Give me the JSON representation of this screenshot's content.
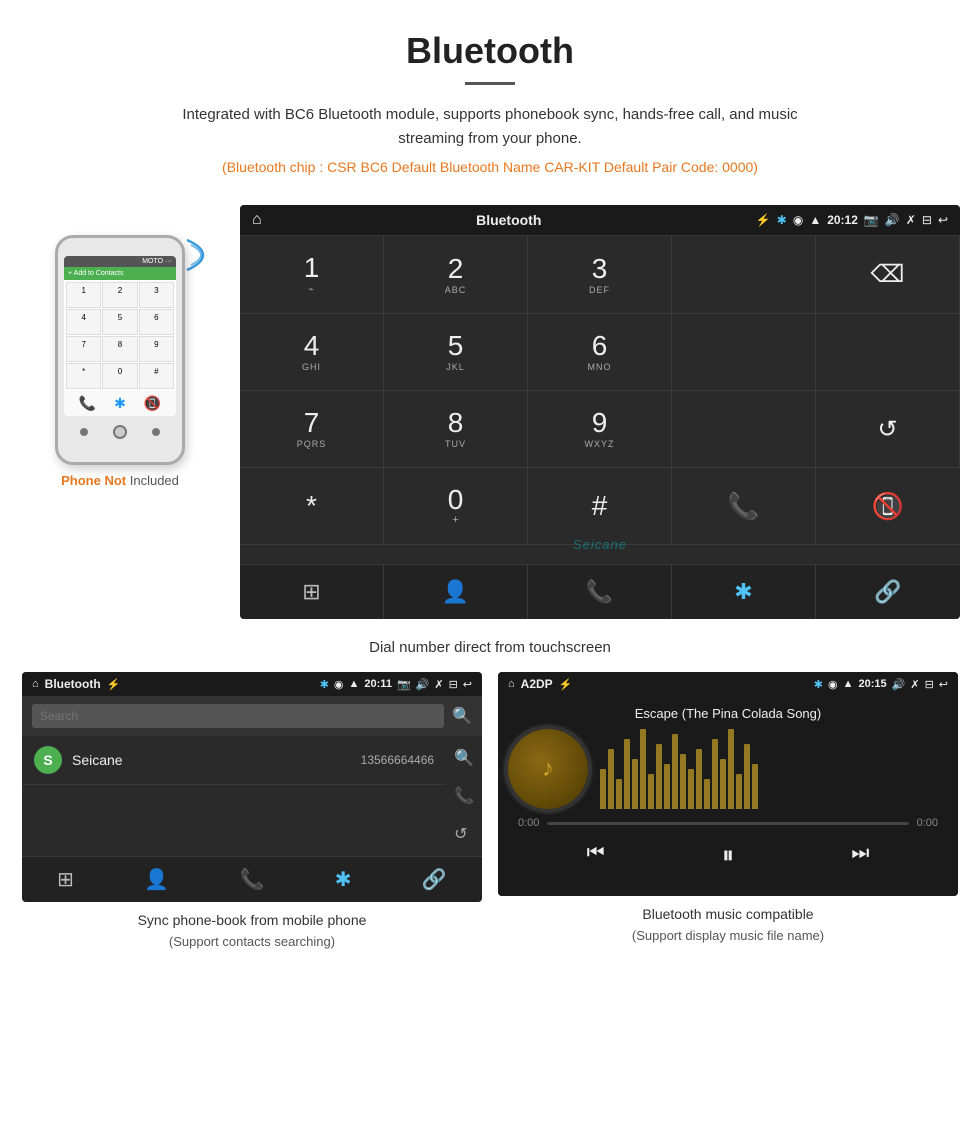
{
  "page": {
    "title": "Bluetooth",
    "subtitle": "Integrated with BC6 Bluetooth module, supports phonebook sync, hands-free call, and music streaming from your phone.",
    "specs": "(Bluetooth chip : CSR BC6    Default Bluetooth Name CAR-KIT    Default Pair Code: 0000)",
    "caption_main": "Dial number direct from touchscreen",
    "caption_phonebook": "Sync phone-book from mobile phone",
    "caption_phonebook_sub": "(Support contacts searching)",
    "caption_music": "Bluetooth music compatible",
    "caption_music_sub": "(Support display music file name)"
  },
  "phone": {
    "not_included_1": "Phone Not",
    "not_included_2": "Included"
  },
  "car_screen": {
    "statusbar": {
      "left_icon": "🏠",
      "center": "Bluetooth",
      "usb_icon": "⚡",
      "time": "20:12",
      "right_icons": [
        "📷",
        "🔊",
        "✗",
        "⊟",
        "↩"
      ]
    },
    "dialpad": [
      {
        "num": "1",
        "sub": "⌁"
      },
      {
        "num": "2",
        "sub": "ABC"
      },
      {
        "num": "3",
        "sub": "DEF"
      },
      {
        "num": "",
        "sub": ""
      },
      {
        "num": "⌫",
        "sub": ""
      },
      {
        "num": "4",
        "sub": "GHI"
      },
      {
        "num": "5",
        "sub": "JKL"
      },
      {
        "num": "6",
        "sub": "MNO"
      },
      {
        "num": "",
        "sub": ""
      },
      {
        "num": "",
        "sub": ""
      },
      {
        "num": "7",
        "sub": "PQRS"
      },
      {
        "num": "8",
        "sub": "TUV"
      },
      {
        "num": "9",
        "sub": "WXYZ"
      },
      {
        "num": "",
        "sub": ""
      },
      {
        "num": "↺",
        "sub": ""
      },
      {
        "num": "*",
        "sub": ""
      },
      {
        "num": "0",
        "sub": "+"
      },
      {
        "num": "#",
        "sub": ""
      },
      {
        "num": "📞",
        "sub": "call"
      },
      {
        "num": "📵",
        "sub": "hangup"
      }
    ],
    "bottom_icons": [
      "⊞",
      "👤",
      "📞",
      "✱",
      "🔗"
    ],
    "watermark": "Seicane"
  },
  "phonebook_screen": {
    "statusbar_left": [
      "🏠",
      "Bluetooth",
      "⚡"
    ],
    "statusbar_right": [
      "✱",
      "📍",
      "📶",
      "20:11",
      "📷",
      "🔊",
      "✗",
      "⊟",
      "↩"
    ],
    "search_placeholder": "Search",
    "contact": {
      "letter": "S",
      "name": "Seicane",
      "number": "13566664466"
    },
    "side_icons": [
      "🔍",
      "📞",
      "↺"
    ],
    "bottom_icons": [
      "⊞",
      "👤",
      "📞",
      "✱",
      "🔗"
    ]
  },
  "music_screen": {
    "statusbar_left": [
      "🏠",
      "A2DP",
      "⚡"
    ],
    "statusbar_right": [
      "✱",
      "📍",
      "📶",
      "20:15",
      "🔊",
      "✗",
      "⊟",
      "↩"
    ],
    "song_title": "Escape (The Pina Colada Song)",
    "eq_bars": [
      40,
      60,
      30,
      70,
      50,
      80,
      35,
      65,
      45,
      75,
      55,
      40,
      60,
      30,
      70,
      50,
      80,
      35,
      65,
      45
    ],
    "controls": [
      "⏮",
      "⏭",
      "⏸",
      "⏭"
    ]
  }
}
